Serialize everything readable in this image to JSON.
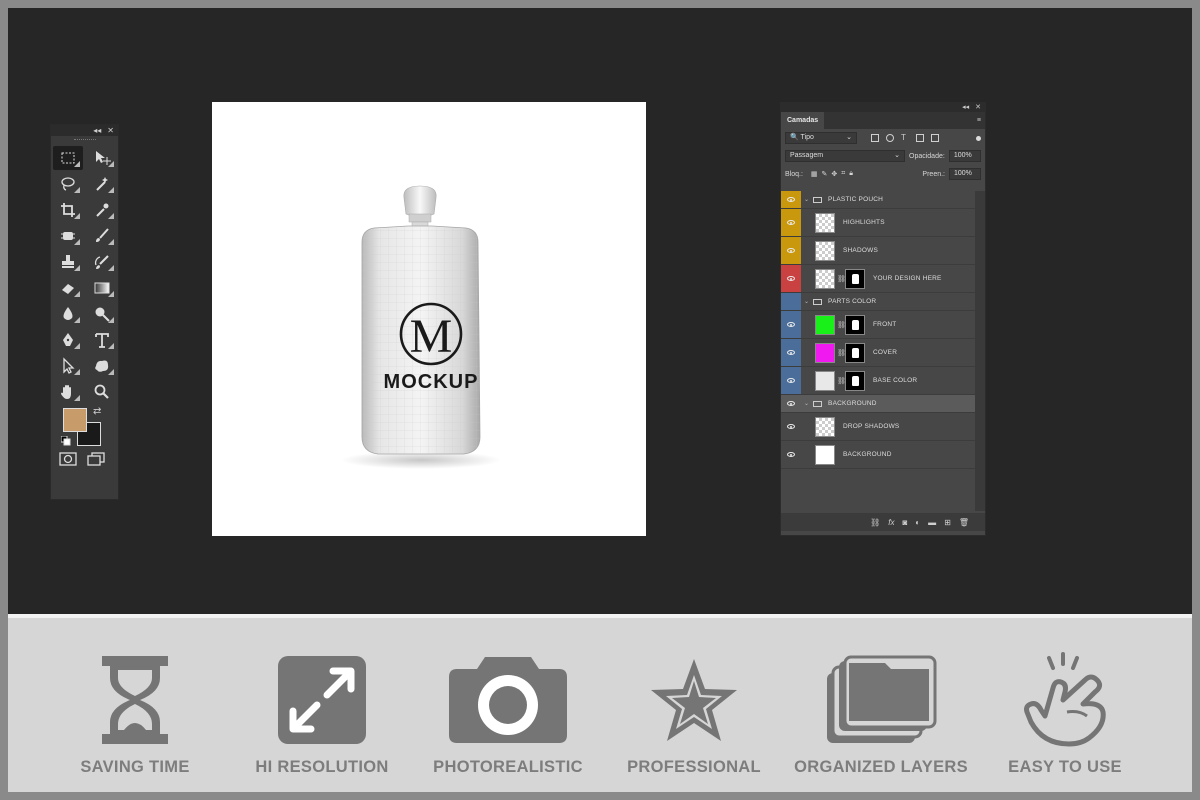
{
  "toolbox": {
    "collapse_glyph": "◂◂",
    "close_glyph": "✕",
    "tools": [
      {
        "name": "rectangular-marquee-icon",
        "selected": true
      },
      {
        "name": "move-icon"
      },
      {
        "name": "lasso-icon"
      },
      {
        "name": "magic-wand-icon"
      },
      {
        "name": "crop-icon"
      },
      {
        "name": "eyedropper-icon"
      },
      {
        "name": "spot-healing-icon"
      },
      {
        "name": "brush-icon"
      },
      {
        "name": "clone-stamp-icon"
      },
      {
        "name": "history-brush-icon"
      },
      {
        "name": "eraser-icon"
      },
      {
        "name": "gradient-icon"
      },
      {
        "name": "blur-icon"
      },
      {
        "name": "dodge-icon"
      },
      {
        "name": "pen-icon"
      },
      {
        "name": "type-icon"
      },
      {
        "name": "path-selection-icon"
      },
      {
        "name": "custom-shape-icon"
      },
      {
        "name": "hand-icon"
      },
      {
        "name": "zoom-icon"
      }
    ],
    "foreground_color": "#c89c6a",
    "background_color": "#1a1a1a"
  },
  "canvas": {
    "product_text": "MOCKUP",
    "monogram": "M"
  },
  "layers_panel": {
    "tab_label": "Camadas",
    "filter_label": "Tipo",
    "blend_mode": "Passagem",
    "opacity_label": "Opacidade:",
    "opacity_value": "100%",
    "lock_label": "Bloq.:",
    "fill_label": "Preen.:",
    "fill_value": "100%",
    "layers": [
      {
        "kind": "group",
        "name": "PLASTIC POUCH",
        "tag": "yellow"
      },
      {
        "kind": "layer",
        "name": "HIGHLIGHTS",
        "tag": "yellow",
        "thumb": "checker-shape"
      },
      {
        "kind": "layer",
        "name": "SHADOWS",
        "tag": "yellow",
        "thumb": "checker"
      },
      {
        "kind": "layer",
        "name": "YOUR DESIGN HERE",
        "tag": "red",
        "thumb": "smart",
        "mask": true
      },
      {
        "kind": "group",
        "name": "PARTS COLOR",
        "tag": "blue",
        "hidden_eye": true
      },
      {
        "kind": "layer",
        "name": "FRONT",
        "tag": "blue",
        "thumb": "#19f019",
        "mask": true
      },
      {
        "kind": "layer",
        "name": "COVER",
        "tag": "blue",
        "thumb": "#f019f0",
        "mask": true
      },
      {
        "kind": "layer",
        "name": "BASE COLOR",
        "tag": "blue",
        "thumb": "#e8e8e8",
        "mask": true
      },
      {
        "kind": "group",
        "name": "BACKGROUND",
        "tag": "none",
        "selected": true
      },
      {
        "kind": "layer",
        "name": "DROP SHADOWS",
        "tag": "none",
        "thumb": "checker"
      },
      {
        "kind": "layer",
        "name": "BACKGROUND",
        "tag": "none",
        "thumb": "#ffffff"
      }
    ],
    "footer_icons": [
      "link-icon",
      "fx-icon",
      "mask-icon",
      "adjustment-icon",
      "folder-icon",
      "new-layer-icon",
      "trash-icon"
    ]
  },
  "features": [
    {
      "label": "SAVING TIME",
      "icon": "hourglass-icon"
    },
    {
      "label": "HI RESOLUTION",
      "icon": "expand-arrows-icon"
    },
    {
      "label": "PHOTOREALISTIC",
      "icon": "camera-icon"
    },
    {
      "label": "PROFESSIONAL",
      "icon": "star-icon"
    },
    {
      "label": "ORGANIZED LAYERS",
      "icon": "layers-icon"
    },
    {
      "label": "EASY TO USE",
      "icon": "pointing-hand-icon"
    }
  ],
  "colors": {
    "workspace": "#262626",
    "features_bg": "#d6d6d6",
    "feature_icon": "#757575"
  }
}
